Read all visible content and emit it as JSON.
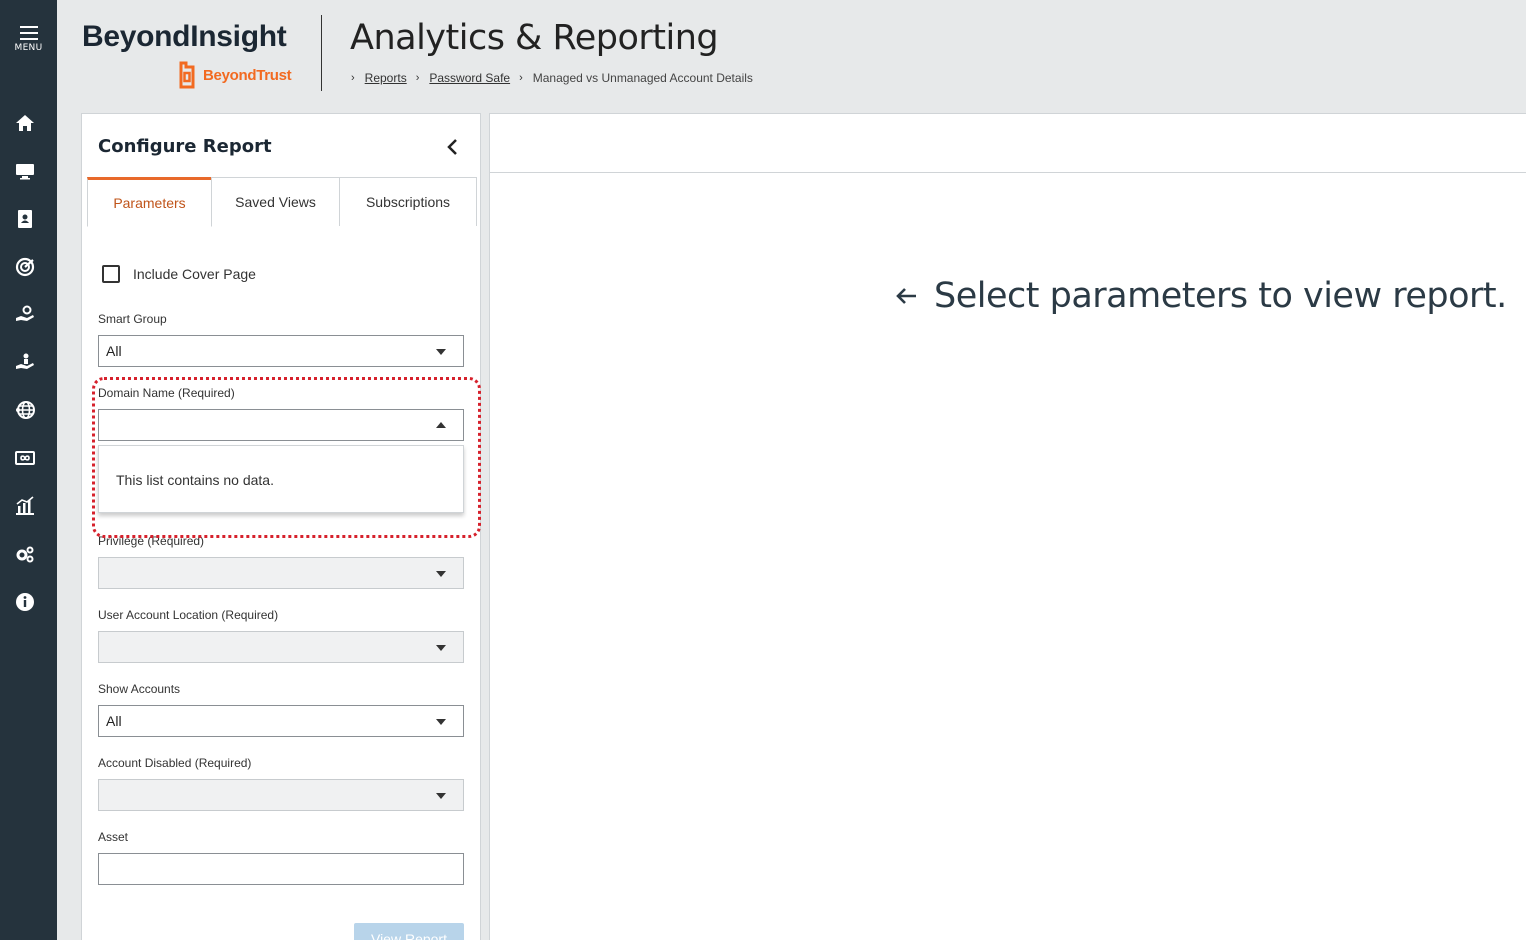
{
  "nav": {
    "menu_label": "MENU",
    "icons": [
      "home-icon",
      "monitor-icon",
      "address-book-icon",
      "radar-icon",
      "hand-gear-icon",
      "hand-person-icon",
      "globe-icon",
      "infinity-card-icon",
      "chart-icon",
      "gears-icon",
      "info-icon"
    ]
  },
  "header": {
    "brand": "BeyondInsight",
    "logo_text": "BeyondTrust",
    "title": "Analytics & Reporting",
    "breadcrumb": {
      "sep": "›",
      "reports": "Reports",
      "password_safe": "Password Safe",
      "current": "Managed vs Unmanaged Account Details"
    }
  },
  "config": {
    "title": "Configure Report",
    "tabs": [
      "Parameters",
      "Saved Views",
      "Subscriptions"
    ],
    "active_tab": "Parameters",
    "include_cover_page": {
      "label": "Include Cover Page",
      "checked": false
    },
    "fields": {
      "smart_group": {
        "label": "Smart Group",
        "value": "All"
      },
      "domain_name": {
        "label": "Domain Name (Required)",
        "value": "",
        "empty_message": "This list contains no data."
      },
      "privilege": {
        "label": "Privilege (Required)",
        "value": ""
      },
      "user_account_location": {
        "label": "User Account Location (Required)",
        "value": ""
      },
      "show_accounts": {
        "label": "Show Accounts",
        "value": "All"
      },
      "account_disabled": {
        "label": "Account Disabled (Required)",
        "value": ""
      },
      "asset": {
        "label": "Asset",
        "value": ""
      }
    },
    "view_report_label": "View Report"
  },
  "report": {
    "message": "Select parameters to view report."
  },
  "colors": {
    "nav_bg": "#25333d",
    "accent_orange": "#e8692a",
    "highlight_red": "#d6212c",
    "disabled_button": "#b8d4ea"
  }
}
